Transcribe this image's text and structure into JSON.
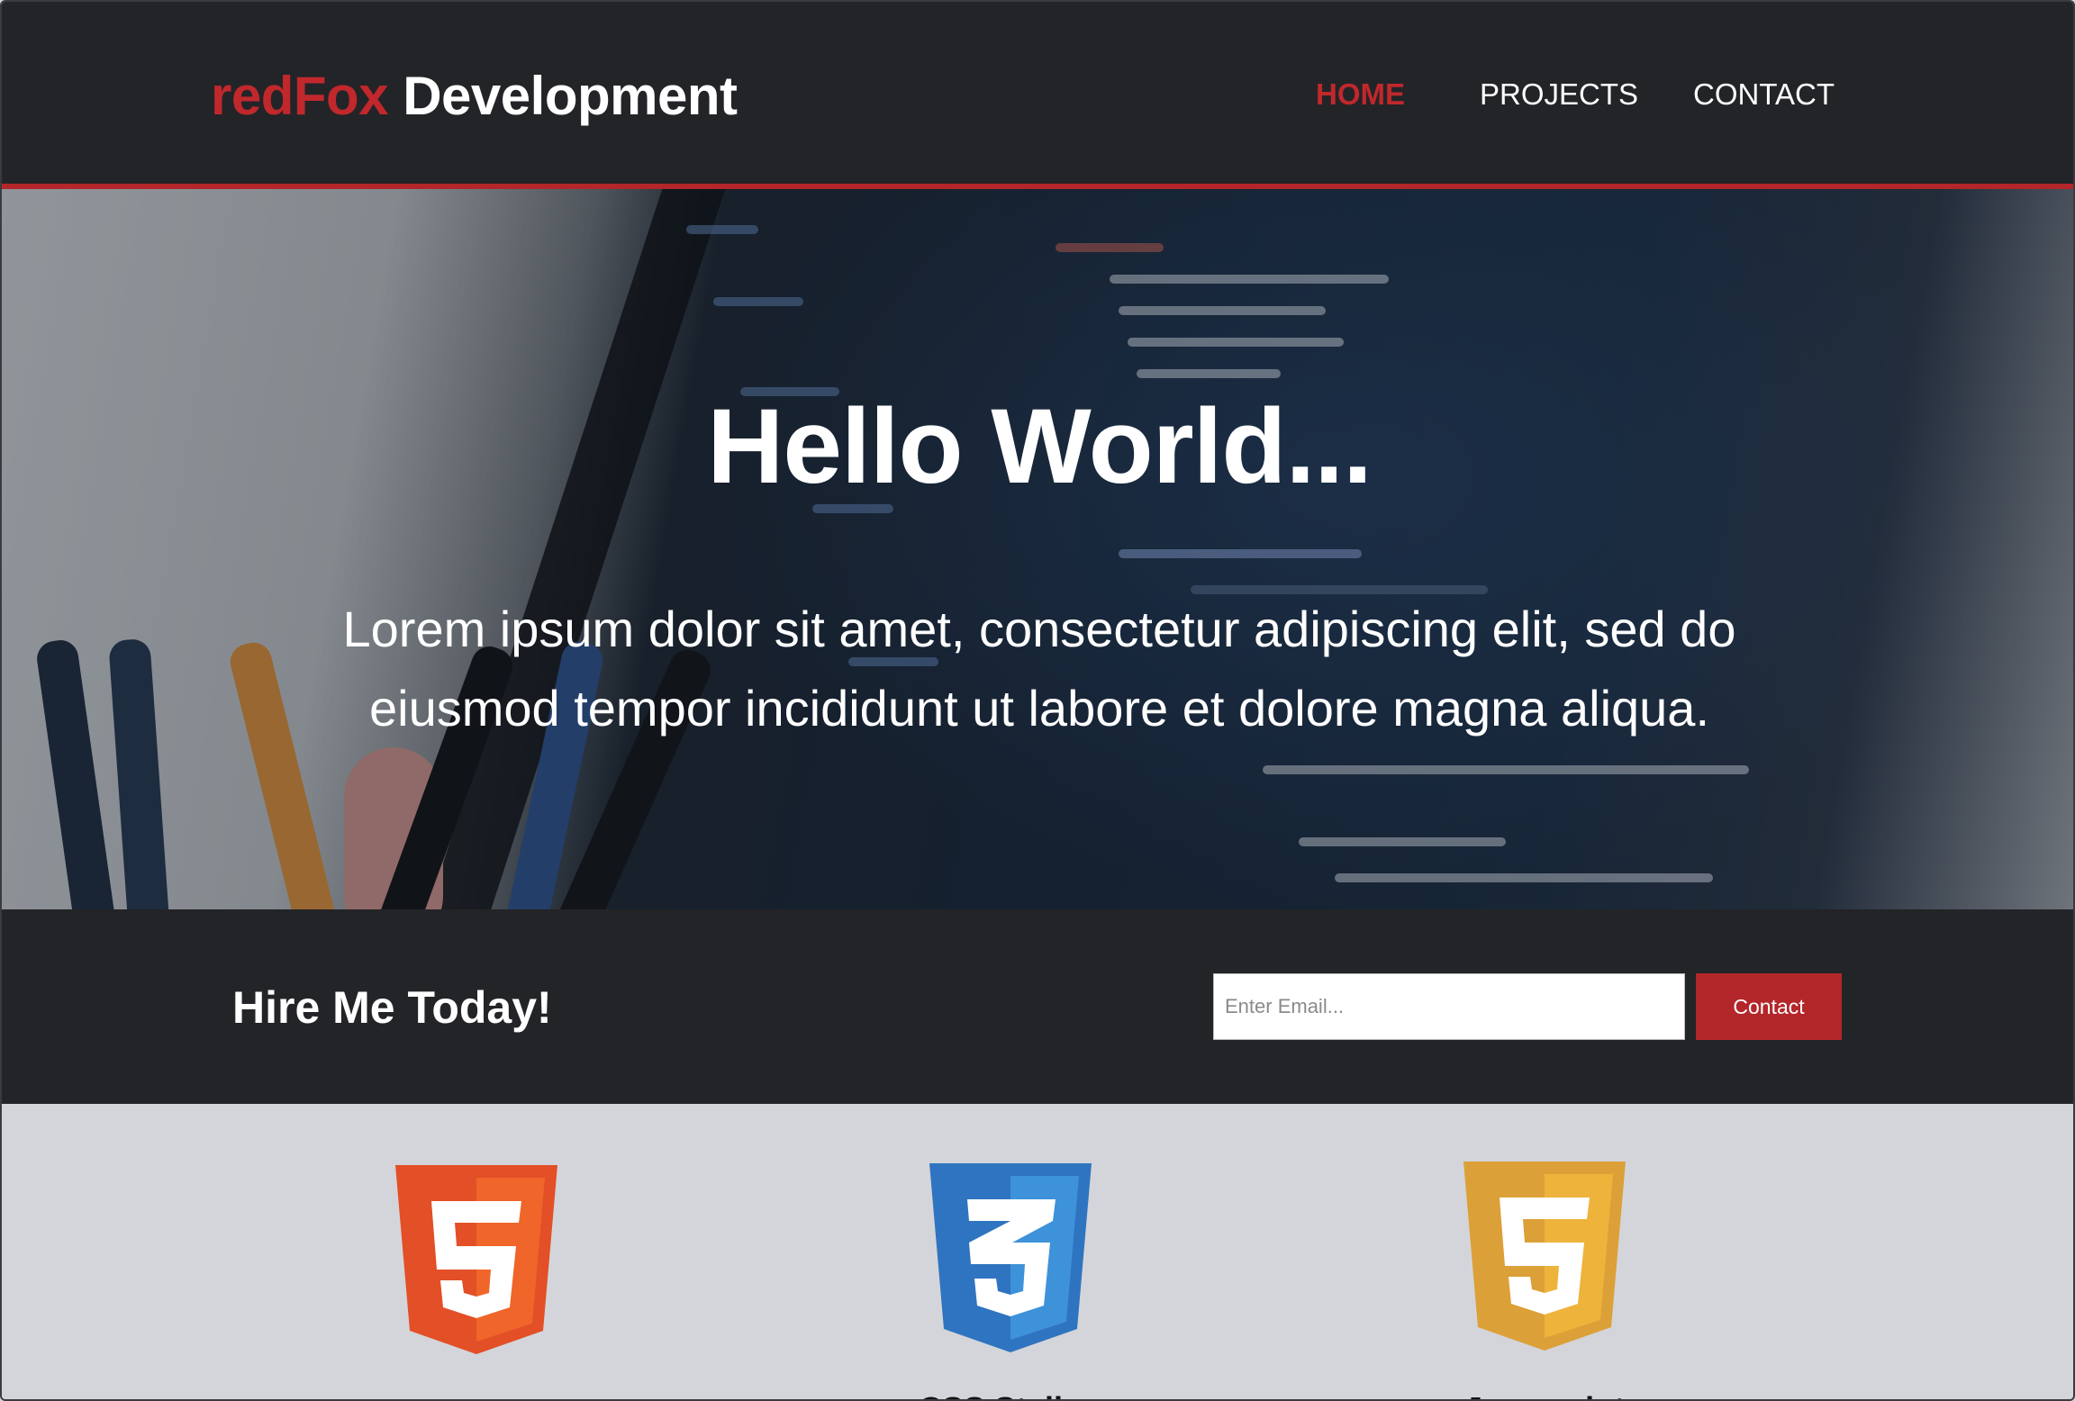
{
  "header": {
    "logo_brand": "redFox",
    "logo_rest": "Development",
    "nav": [
      {
        "label": "HOME",
        "active": true
      },
      {
        "label": "PROJECTS",
        "active": false
      },
      {
        "label": "CONTACT",
        "active": false
      }
    ]
  },
  "hero": {
    "title": "Hello World...",
    "text": "Lorem ipsum dolor sit amet, consectetur adipiscing elit, sed do eiusmod tempor incididunt ut labore et dolore magna aliqua."
  },
  "hire": {
    "title": "Hire Me Today!",
    "email_placeholder": "Enter Email...",
    "button_label": "Contact"
  },
  "skills": [
    {
      "icon": "html5-icon",
      "label": "",
      "color": "#e34f26"
    },
    {
      "icon": "css3-icon",
      "label": "CSS Styling",
      "color": "#2965f1"
    },
    {
      "icon": "javascript-icon",
      "label": "Javascript",
      "color": "#e0a030"
    }
  ],
  "colors": {
    "accent": "#b3262a",
    "header_bg": "#232427",
    "skills_bg": "#d4d5da"
  }
}
